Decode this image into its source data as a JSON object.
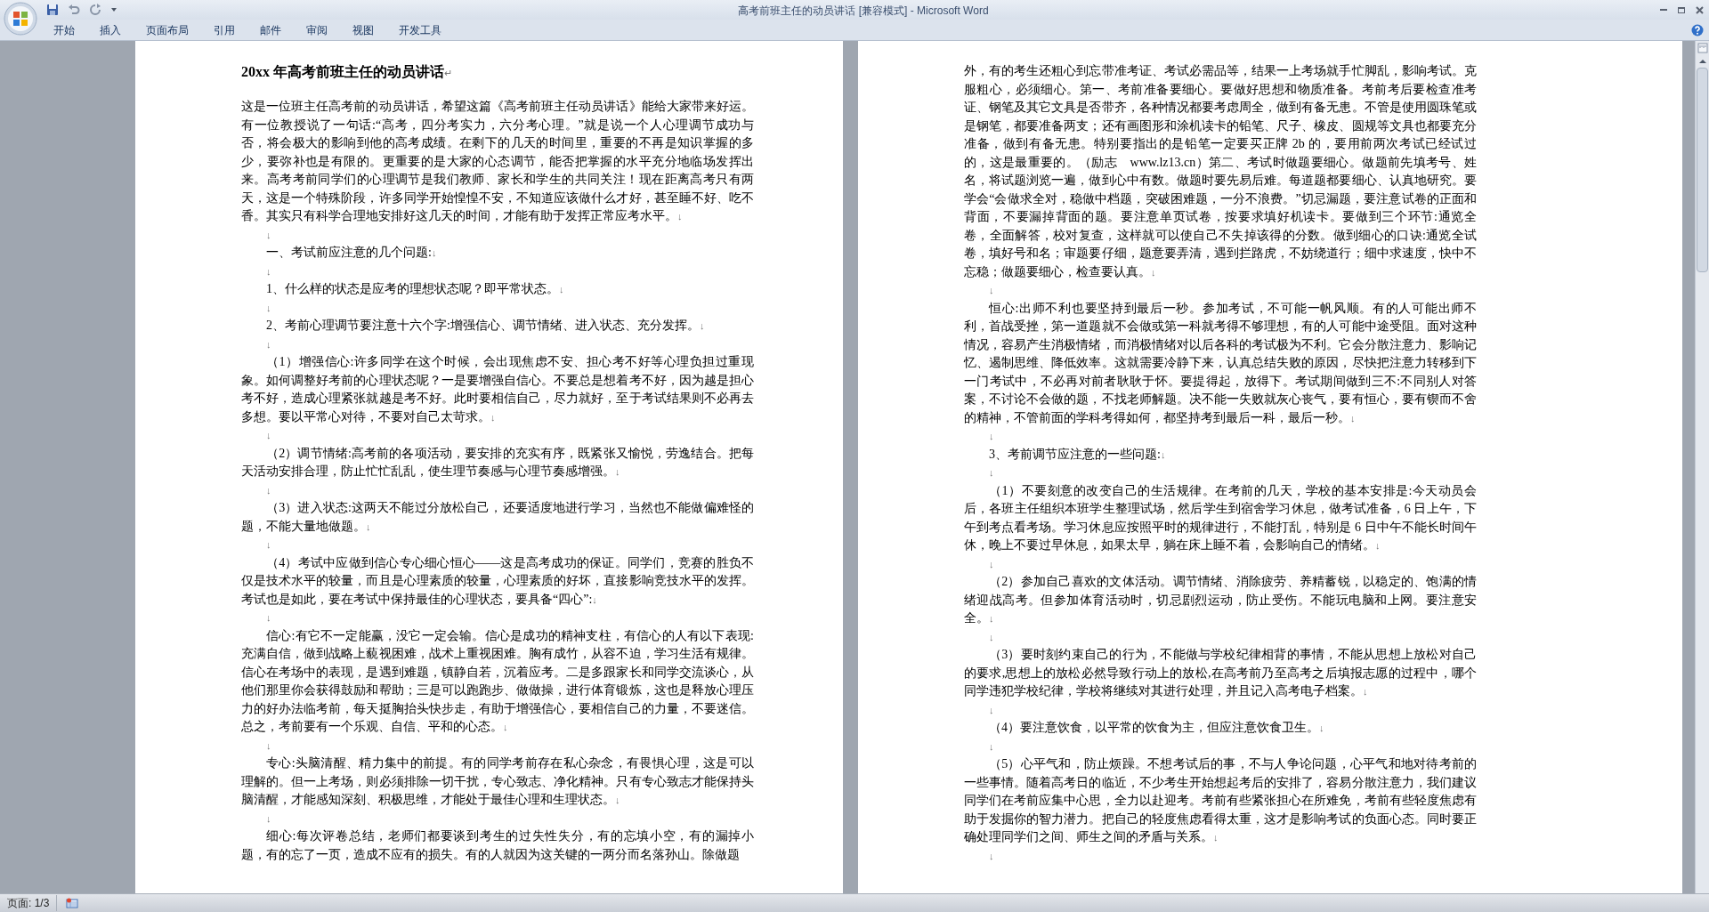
{
  "window": {
    "title": "高考前班主任的动员讲话 [兼容模式] - Microsoft Word"
  },
  "ribbon_tabs": [
    "开始",
    "插入",
    "页面布局",
    "引用",
    "邮件",
    "审阅",
    "视图",
    "开发工具"
  ],
  "pages": [
    {
      "paragraphs": [
        {
          "kind": "title",
          "text": "20xx 年高考前班主任的动员讲话",
          "mark": "↵"
        },
        {
          "kind": "plain",
          "text": "这是一位班主任高考前的动员讲话，希望这篇《高考前班主任动员讲话》能给大家带来好运。有一位教授说了一句话:“高考，四分考实力，六分考心理。”就是说一个人心理调节成功与否，将会极大的影响到他的高考成绩。在剩下的几天的时间里，重要的不再是知识掌握的多少，要弥补也是有限的。更重要的是大家的心态调节，能否把掌握的水平充分地临场发挥出来。高考考前同学们的心理调节是我们教师、家长和学生的共同关注！现在距离高考只有两天，这是一个特殊阶段，许多同学开始惶惶不安，不知道应该做什么才好，甚至睡不好、吃不香。其实只有科学合理地安排好这几天的时间，才能有助于发挥正常应考水平。",
          "mark": "↓"
        },
        {
          "kind": "body",
          "mark": "↓"
        },
        {
          "kind": "body",
          "text": "一、考试前应注意的几个问题:",
          "mark": "↓"
        },
        {
          "kind": "body",
          "mark": "↓"
        },
        {
          "kind": "body",
          "text": "1、什么样的状态是应考的理想状态呢？即平常状态。",
          "mark": "↓"
        },
        {
          "kind": "body",
          "mark": "↓"
        },
        {
          "kind": "body",
          "text": "2、考前心理调节要注意十六个字:增强信心、调节情绪、进入状态、充分发挥。",
          "mark": "↓"
        },
        {
          "kind": "body",
          "mark": "↓"
        },
        {
          "kind": "body",
          "text": "（1）增强信心:许多同学在这个时候，会出现焦虑不安、担心考不好等心理负担过重现象。如何调整好考前的心理状态呢？一是要增强自信心。不要总是想着考不好，因为越是担心考不好，造成心理紧张就越是考不好。此时要相信自己，尽力就好，至于考试结果则不必再去多想。要以平常心对待，不要对自己太苛求。",
          "mark": "↓"
        },
        {
          "kind": "body",
          "mark": "↓"
        },
        {
          "kind": "body",
          "text": "（2）调节情绪:高考前的各项活动，要安排的充实有序，既紧张又愉悦，劳逸结合。把每天活动安排合理，防止忙忙乱乱，使生理节奏感与心理节奏感增强。",
          "mark": "↓"
        },
        {
          "kind": "body",
          "mark": "↓"
        },
        {
          "kind": "body",
          "text": "（3）进入状态:这两天不能过分放松自己，还要适度地进行学习，当然也不能做偏难怪的题，不能大量地做题。",
          "mark": "↓"
        },
        {
          "kind": "body",
          "mark": "↓"
        },
        {
          "kind": "body",
          "text": "（4）考试中应做到信心专心细心恒心——这是高考成功的保证。同学们，竞赛的胜负不仅是技术水平的较量，而且是心理素质的较量，心理素质的好坏，直接影响竞技水平的发挥。考试也是如此，要在考试中保持最佳的心理状态，要具备“四心”:",
          "mark": "↓"
        },
        {
          "kind": "body",
          "mark": "↓"
        },
        {
          "kind": "body",
          "text": "信心:有它不一定能赢，没它一定会输。信心是成功的精神支柱，有信心的人有以下表现:充满自信，做到战略上藐视困难，战术上重视困难。胸有成竹，从容不迫，学习生活有规律。信心在考场中的表现，是遇到难题，镇静自若，沉着应考。二是多跟家长和同学交流谈心，从他们那里你会获得鼓励和帮助；三是可以跑跑步、做做操，进行体育锻炼，这也是释放心理压力的好办法临考前，每天挺胸抬头快步走，有助于增强信心，要相信自己的力量，不要迷信。总之，考前要有一个乐观、自信、平和的心态。",
          "mark": "↓"
        },
        {
          "kind": "body",
          "mark": "↓"
        },
        {
          "kind": "body",
          "text": "专心:头脑清醒、精力集中的前提。有的同学考前存在私心杂念，有畏惧心理，这是可以理解的。但一上考场，则必须排除一切干扰，专心致志、净化精神。只有专心致志才能保持头脑清醒，才能感知深刻、积极思维，才能处于最佳心理和生理状态。",
          "mark": "↓"
        },
        {
          "kind": "body",
          "mark": "↓"
        },
        {
          "kind": "body",
          "text": "细心:每次评卷总结，老师们都要谈到考生的过失性失分，有的忘填小空，有的漏掉小题，有的忘了一页，造成不应有的损失。有的人就因为这关键的一两分而名落孙山。除做题"
        }
      ]
    },
    {
      "paragraphs": [
        {
          "kind": "plain",
          "text": "外，有的考生还粗心到忘带准考证、考试必需品等，结果一上考场就手忙脚乱，影响考试。克服粗心，必须细心。第一、考前准备要细心。要做好思想和物质准备。考前考后要检查准考证、钢笔及其它文具是否带齐，各种情况都要考虑周全，做到有备无患。不管是使用圆珠笔或是钢笔，都要准备两支；还有画图形和涂机读卡的铅笔、尺子、橡皮、圆规等文具也都要充分准备，做到有备无患。特别要指出的是铅笔一定要买正牌 2b 的，要用前两次考试已经试过的，这是最重要的。（励志　www.lz13.cn）第二、考试时做题要细心。做题前先填考号、姓名，将试题浏览一遍，做到心中有数。做题时要先易后难。每道题都要细心、认真地研究。要学会“会做求全对，稳做中档题，突破困难题，一分不浪费。”切忌漏题，要注意试卷的正面和背面，不要漏掉背面的题。要注意单页试卷，按要求填好机读卡。要做到三个环节:通览全卷，全面解答，校对复查，这样就可以使自己不失掉该得的分数。做到细心的口诀:通览全试卷，填好号和名；审题要仔细，题意要弄清，遇到拦路虎，不妨绕道行；细中求速度，快中不忘稳；做题要细心，检查要认真。",
          "mark": "↓"
        },
        {
          "kind": "body",
          "mark": "↓"
        },
        {
          "kind": "body",
          "text": "恒心:出师不利也要坚持到最后一秒。参加考试，不可能一帆风顺。有的人可能出师不利，首战受挫，第一道题就不会做或第一科就考得不够理想，有的人可能中途受阻。面对这种情况，容易产生消极情绪，而消极情绪对以后各科的考试极为不利。它会分散注意力、影响记忆、遏制思维、降低效率。这就需要冷静下来，认真总结失败的原因，尽快把注意力转移到下一门考试中，不必再对前者耿耿于怀。要提得起，放得下。考试期间做到三不:不同别人对答案，不讨论不会做的题，不找老师解题。决不能一失败就灰心丧气，要有恒心，要有锲而不舍的精神，不管前面的学科考得如何，都坚持考到最后一科，最后一秒。",
          "mark": "↓"
        },
        {
          "kind": "body",
          "mark": "↓"
        },
        {
          "kind": "body",
          "text": "3、考前调节应注意的一些问题:",
          "mark": "↓"
        },
        {
          "kind": "body",
          "mark": "↓"
        },
        {
          "kind": "body",
          "text": "（1）不要刻意的改变自己的生活规律。在考前的几天，学校的基本安排是:今天动员会后，各班主任组织本班学生整理试场，然后学生到宿舍学习休息，做考试准备，6 日上午，下午到考点看考场。学习休息应按照平时的规律进行，不能打乱，特别是 6 日中午不能长时间午休，晚上不要过早休息，如果太早，躺在床上睡不着，会影响自己的情绪。",
          "mark": "↓"
        },
        {
          "kind": "body",
          "mark": "↓"
        },
        {
          "kind": "body",
          "text": "（2）参加自己喜欢的文体活动。调节情绪、消除疲劳、养精蓄锐，以稳定的、饱满的情绪迎战高考。但参加体育活动时，切忌剧烈运动，防止受伤。不能玩电脑和上网。要注意安全。",
          "mark": "↓"
        },
        {
          "kind": "body",
          "mark": "↓"
        },
        {
          "kind": "body",
          "text": "（3）要时刻约束自己的行为，不能做与学校纪律相背的事情，不能从思想上放松对自己的要求,思想上的放松必然导致行动上的放松,在高考前乃至高考之后填报志愿的过程中，哪个同学违犯学校纪律，学校将继续对其进行处理，并且记入高考电子档案。",
          "mark": "↓"
        },
        {
          "kind": "body",
          "mark": "↓"
        },
        {
          "kind": "body",
          "text": "（4）要注意饮食，以平常的饮食为主，但应注意饮食卫生。",
          "mark": "↓"
        },
        {
          "kind": "body",
          "mark": "↓"
        },
        {
          "kind": "body",
          "text": "（5）心平气和，防止烦躁。不想考试后的事，不与人争论问题，心平气和地对待考前的一些事情。随着高考日的临近，不少考生开始想起考后的安排了，容易分散注意力，我们建议同学们在考前应集中心思，全力以赴迎考。考前有些紧张担心在所难免，考前有些轻度焦虑有助于发掘你的智力潜力。把自己的轻度焦虑看得太重，这才是影响考试的负面心态。同时要正确处理同学们之间、师生之间的矛盾与关系。",
          "mark": "↓"
        },
        {
          "kind": "body",
          "mark": "↓"
        }
      ]
    }
  ],
  "status_bar": {
    "page": "页面: 1/3"
  }
}
